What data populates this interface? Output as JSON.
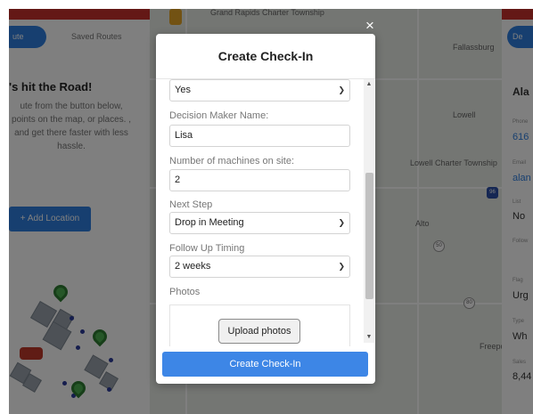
{
  "background": {
    "left_panel": {
      "active_tab": "ute",
      "other_tab": "Saved Routes",
      "heading": "'s hit the Road!",
      "text": "ute from the button below, points on the map, or places. , and get there faster with less hassle.",
      "add_location": "+ Add Location"
    },
    "map": {
      "places": [
        "Grand Rapids Charter Township",
        "Fallassburg",
        "Lowell",
        "Lowell Charter Township",
        "Alto",
        "Freepor"
      ],
      "shields": [
        "96",
        "50",
        "80"
      ]
    },
    "right_panel": {
      "tab": "De",
      "name": "Ala",
      "labels": [
        "Phone",
        "Email",
        "List",
        "Follow",
        "Flag",
        "Type",
        "Sales"
      ],
      "values": [
        "616",
        "alan",
        "No",
        "Urg",
        "Wh",
        "8,44"
      ]
    }
  },
  "modal": {
    "close_label": "×",
    "title": "Create Check-In",
    "fields": {
      "top_select_value": "Yes",
      "decision_maker_label": "Decision Maker Name:",
      "decision_maker_value": "Lisa",
      "machines_label": "Number of machines on site:",
      "machines_value": "2",
      "next_step_label": "Next Step",
      "next_step_value": "Drop in Meeting",
      "follow_up_label": "Follow Up Timing",
      "follow_up_value": "2 weeks",
      "photos_label": "Photos",
      "upload_label": "Upload photos"
    },
    "submit_label": "Create Check-In",
    "icons": {
      "close": "close-icon",
      "dropdown": "chevron-down-icon",
      "scroll_up": "arrow-up-icon",
      "scroll_down": "arrow-down-icon"
    },
    "colors": {
      "primary": "#3d86e6",
      "header_red": "#c9302c"
    }
  }
}
